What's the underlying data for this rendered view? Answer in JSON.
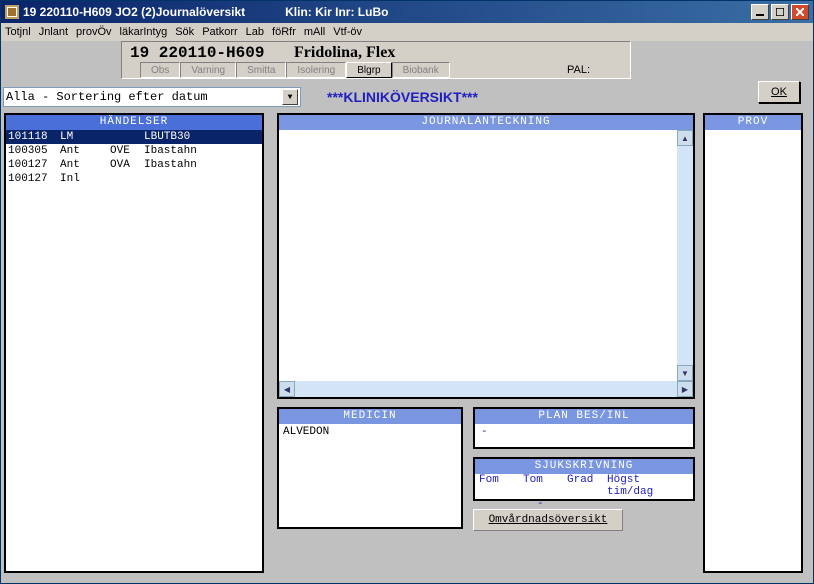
{
  "window": {
    "title_left": "19 220110-H609   JO2 (2)Journalöversikt",
    "title_mid": "Klin: Kir  Inr: LuBo"
  },
  "menu": {
    "items": [
      "Totjnl",
      "Jnlant",
      "provÖv",
      "läkarIntyg",
      "Sök",
      "Patkorr",
      "Lab",
      "föRfr",
      "mAll",
      "Vtf-öv"
    ]
  },
  "patient": {
    "id": "19 220110-H609",
    "name": "Fridolina, Flex",
    "tabs": {
      "obs": "Obs",
      "varning": "Varning",
      "smitta": "Smitta",
      "isolering": "Isolering",
      "blgrp": "Blgrp",
      "biobank": "Biobank"
    },
    "pal_label": "PAL:"
  },
  "sort": {
    "value": "Alla   - Sortering efter datum",
    "heading": "***KLINIKÖVERSIKT***"
  },
  "ok_button": "OK",
  "handelser": {
    "title": "HÄNDELSER",
    "rows": [
      {
        "d": "101118",
        "t": "LM",
        "c": "",
        "n": "LBUTB30",
        "sel": true
      },
      {
        "d": "100305",
        "t": "Ant",
        "c": "OVE",
        "n": "Ibastahn",
        "sel": false
      },
      {
        "d": "100127",
        "t": "Ant",
        "c": "OVA",
        "n": "Ibastahn",
        "sel": false
      },
      {
        "d": "100127",
        "t": "Inl",
        "c": "",
        "n": "",
        "sel": false
      }
    ]
  },
  "journal": {
    "title": "JOURNALANTECKNING"
  },
  "prov": {
    "title": "PROV"
  },
  "medicin": {
    "title": "MEDICIN",
    "lines": [
      "ALVEDON"
    ]
  },
  "plan": {
    "title": "PLAN BES/INL",
    "value": "-"
  },
  "sjuk": {
    "title": "SJUKSKRIVNING",
    "cols": [
      "Fom",
      "Tom",
      "Grad",
      "Högst tim/dag"
    ],
    "dash": "-"
  },
  "omvard_button": "Omvårdnadsöversikt"
}
